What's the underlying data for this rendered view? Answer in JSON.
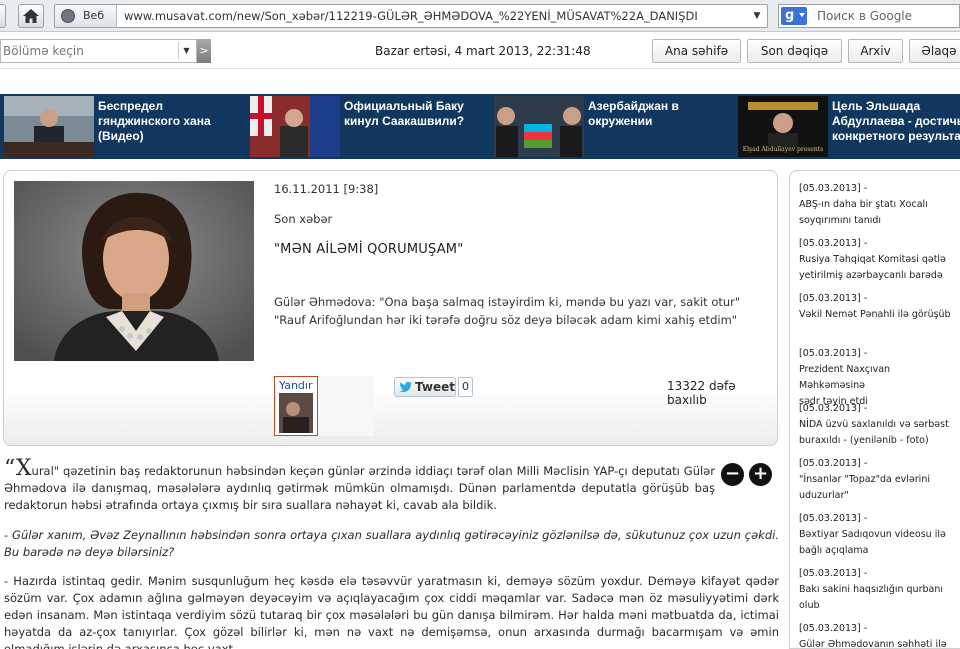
{
  "browser": {
    "url_prefix": "Веб",
    "url": "www.musavat.com/new/Son_xəbər/112219-GÜLƏR_ƏHMƏDOVA_%22YENİ_MÜSAVAT%22A_DANIŞDI",
    "search_placeholder": "Поиск в Google"
  },
  "header": {
    "section_select": "Bölümə keçin",
    "go_label": ">",
    "date": "Bazar ertəsi, 4 mart 2013, 22:31:48",
    "buttons": [
      "Ana səhifə",
      "Son dəqiqə",
      "Arxiv",
      "Əlaqə"
    ]
  },
  "news_strip": [
    {
      "title": "Беспредел гянджинского хана (Видео)"
    },
    {
      "title": "Официальный Баку кинул Саакашвили?"
    },
    {
      "title": "Азербайджан в окружении"
    },
    {
      "title": "Цель Эльшада Абдуллаева - достичь конкретного результата",
      "thumb_caption": "Elşad Abdullayev presents"
    }
  ],
  "article": {
    "date": "16.11.2011 [9:38]",
    "category": "Son xəbər",
    "title": "\"MƏN AİLƏMİ QORUMUŞAM\"",
    "quote1": "Gülər Əhmədova: \"Ona başa salmaq istəyirdim ki, məndə bu yazı var, sakit otur\"",
    "quote2": "\"Rauf Arifoğlundan hər iki tərəfə doğru söz deyə biləcək adam kimi xahiş etdim\"",
    "yandir_label": "Yandır",
    "tweet_label": "Tweet",
    "tweet_count": "0",
    "views": "13322 dəfə baxılıb"
  },
  "body": {
    "dropcap": "X",
    "p1": "ural\" qəzetinin baş redaktorunun həbsindən keçən günlər ərzində iddiaçı tərəf olan Milli Məclisin YAP-çı deputatı Gülər Əhmədova ilə danışmaq, məsələlərə aydınlıq gətirmək mümkün olmamışdı. Dünən parlamentdə deputatla görüşüb baş redaktorun həbsi ətrafında ortaya çıxmış bir sıra suallara nəhayət ki, cavab ala bildik.",
    "p2": "- Gülər xanım, Əvəz Zeynallının həbsindən sonra ortaya çıxan suallara aydınlıq gətirəcəyiniz gözlənilsə də, sükutunuz çox uzun çəkdi. Bu barədə nə deyə bilərsiniz?",
    "p3": "- Hazırda istintaq gedir. Mənim susqunluğum heç kəsdə elə təsəvvür yaratmasın ki, deməyə sözüm yoxdur. Deməyə kifayət qədər sözüm var. Çox adamın ağlına gəlməyən deyəcəyim və açıqlayacağım çox ciddi məqamlar var. Sadəcə mən öz məsuliyyətimi dərk edən insanam. Mən istintaqa verdiyim sözü tutaraq bir çox məsələləri bu gün danışa bilmirəm. Hər halda məni mətbuatda da, ictimai həyatda da az-çox tanıyırlar. Çox gözəl bilirlər ki, mən nə vaxt nə demişəmsə, onun arxasında durmağı bacarmışam və əmin olmadığım işlərin də arxasınca heç vaxt"
  },
  "sidebar": [
    {
      "date": "[05.03.2013] -",
      "text": "ABŞ-ın daha bir ştatı Xocalı\nsoyqırımını tanıdı"
    },
    {
      "date": "[05.03.2013] -",
      "text": "Rusiya Təhqiqat Komitəsi qətlə\nyetirilmiş azərbaycanlı barədə"
    },
    {
      "date": "[05.03.2013] -",
      "text": "Vəkil Nemət Pənahli ilə görüşüb"
    },
    {
      "date": "[05.03.2013] -",
      "text": "Prezident Naxçıvan Məhkəməsinə\nsədr təyin etdi"
    },
    {
      "date": "[05.03.2013] -",
      "text": "NİDA üzvü saxlanıldı və sərbəst\nburaxıldı - (yenilənib - foto)"
    },
    {
      "date": "[05.03.2013] -",
      "text": "\"İnsanlar \"Topaz\"da evlərini\nuduzurlar\""
    },
    {
      "date": "[05.03.2013] -",
      "text": "Bəxtiyar Sadıqovun videosu ilə\nbağlı açıqlama"
    },
    {
      "date": "[05.03.2013] -",
      "text": "Bakı sakini haqsızlığın qurbanı olub"
    },
    {
      "date": "[05.03.2013] -",
      "text": "Gülər Əhmədovanın səhhəti ilə"
    }
  ],
  "colors": {
    "strip_bg": "#12375e",
    "accent": "#c04a2a"
  }
}
